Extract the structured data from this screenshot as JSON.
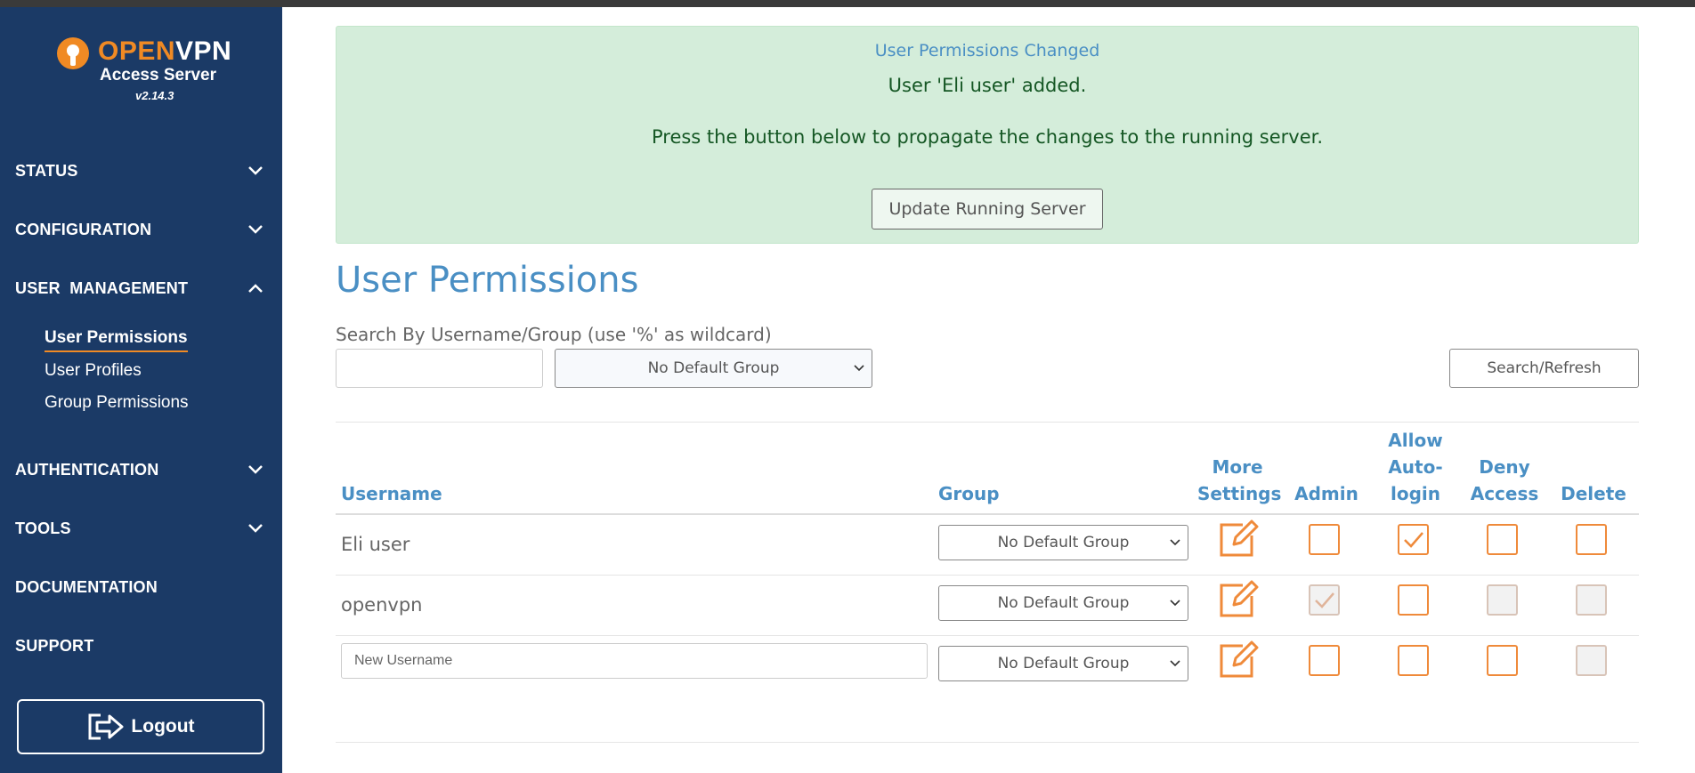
{
  "brand": {
    "open": "OPEN",
    "vpn": "VPN",
    "subtitle": "Access Server",
    "version": "v2.14.3",
    "accent_color": "#f08a24",
    "sidebar_color": "#1b3a66"
  },
  "sidebar": {
    "sections": [
      {
        "label": "STATUS",
        "icon": "chevron-down-icon"
      },
      {
        "label": "CONFIGURATION",
        "icon": "chevron-down-icon"
      },
      {
        "label": "USER  MANAGEMENT",
        "icon": "chevron-up-icon"
      },
      {
        "label": "AUTHENTICATION",
        "icon": "chevron-down-icon"
      },
      {
        "label": "TOOLS",
        "icon": "chevron-down-icon"
      },
      {
        "label": "DOCUMENTATION"
      },
      {
        "label": "SUPPORT"
      }
    ],
    "subitems": [
      {
        "label": "User Permissions",
        "active": true
      },
      {
        "label": "User Profiles"
      },
      {
        "label": "Group Permissions"
      }
    ],
    "logout_label": "Logout"
  },
  "alert": {
    "title": "User Permissions Changed",
    "message1": "User 'Eli user' added.",
    "message2": "Press the button below to propagate the changes to the running server.",
    "button": "Update Running Server"
  },
  "page": {
    "title": "User Permissions",
    "search_label": "Search By Username/Group (use '%' as wildcard)",
    "search_value": "",
    "group_filter": "No Default Group",
    "search_button": "Search/Refresh"
  },
  "table": {
    "headers": {
      "username": "Username",
      "group": "Group",
      "more1": "More",
      "more2": "Settings",
      "admin": "Admin",
      "auto1": "Allow",
      "auto2": "Auto-",
      "auto3": "login",
      "deny1": "Deny",
      "deny2": "Access",
      "delete": "Delete"
    },
    "rows": [
      {
        "username": "Eli user",
        "group": "No Default Group",
        "admin": false,
        "auto_login": true,
        "deny": false,
        "delete": false
      },
      {
        "username": "openvpn",
        "group": "No Default Group",
        "admin": true,
        "auto_login": false,
        "deny": false,
        "delete": false
      },
      {
        "username": "",
        "group": "No Default Group",
        "admin": false,
        "auto_login": false,
        "deny": false,
        "delete": false
      }
    ],
    "new_username_placeholder": "New Username"
  }
}
